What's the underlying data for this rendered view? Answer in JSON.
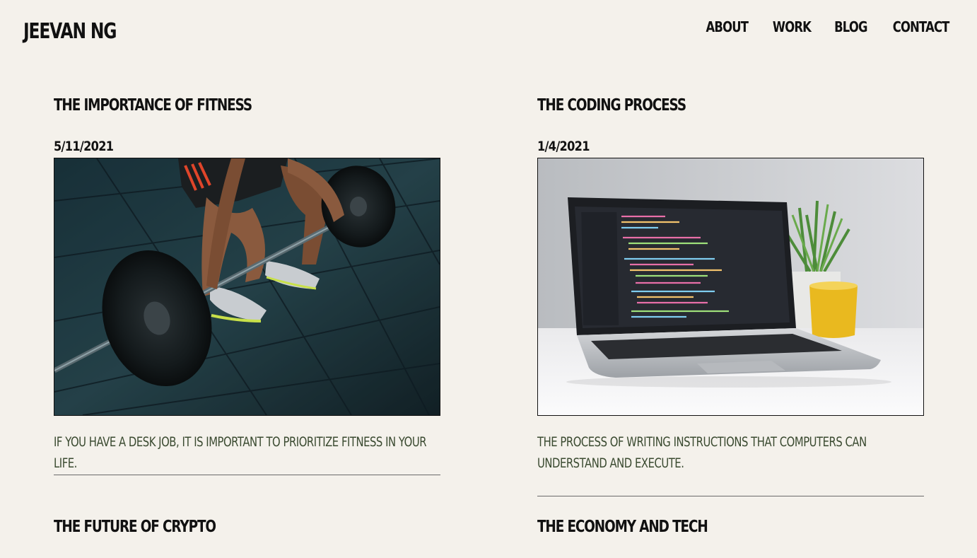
{
  "site": {
    "brand": "JEEVAN NG"
  },
  "nav": {
    "items": [
      "ABOUT",
      "WORK",
      "BLOG",
      "CONTACT"
    ]
  },
  "posts": [
    {
      "title": "THE IMPORTANCE OF FITNESS",
      "date": "5/11/2021",
      "image": "weightlifter-deadlift-photo",
      "excerpt": "IF YOU HAVE A DESK JOB, IT IS IMPORTANT TO PRIORITIZE FITNESS IN YOUR LIFE."
    },
    {
      "title": "THE CODING PROCESS",
      "date": "1/4/2021",
      "image": "laptop-code-editor-photo",
      "excerpt": "THE PROCESS OF WRITING INSTRUCTIONS THAT COMPUTERS CAN UNDERSTAND AND EXECUTE."
    },
    {
      "title": "THE FUTURE OF CRYPTO"
    },
    {
      "title": "THE ECONOMY AND TECH"
    }
  ],
  "colors": {
    "background": "#f4f1eb",
    "text": "#111111",
    "excerpt": "#3a4a30"
  }
}
